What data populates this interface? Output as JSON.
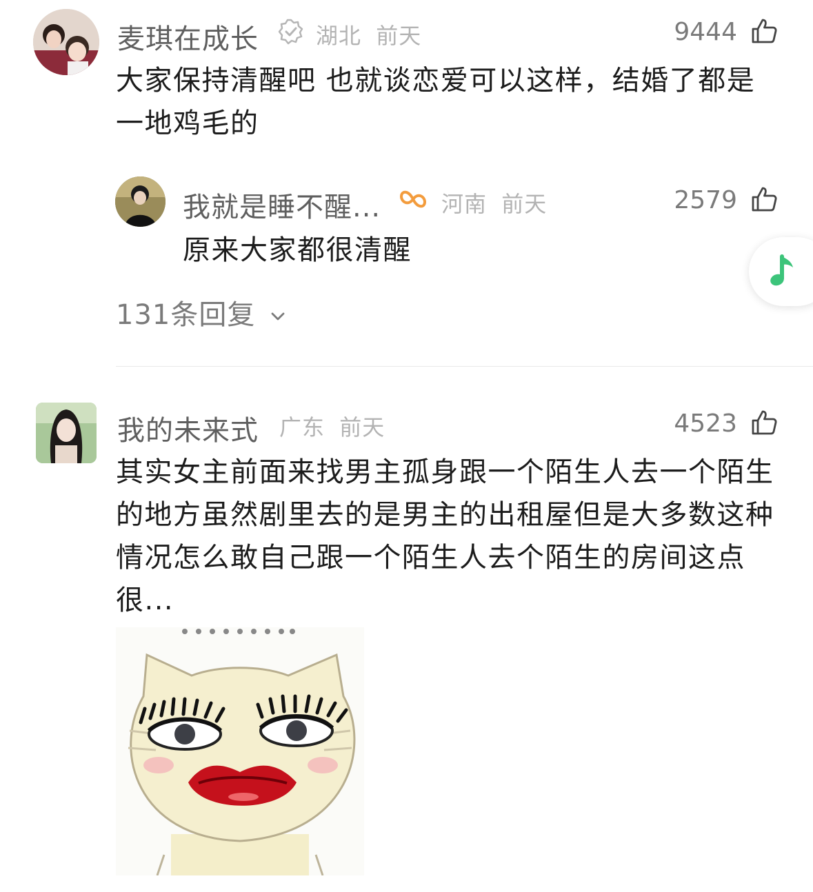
{
  "comment1": {
    "username": "麦琪在成长",
    "location": "湖北",
    "time": "前天",
    "likes": "9444",
    "text": "大家保持清醒吧 也就谈恋爱可以这样，结婚了都是一地鸡毛的",
    "verified_icon": "verified-badge-icon",
    "reply": {
      "username": "我就是睡不醒...",
      "location": "河南",
      "time": "前天",
      "likes": "2579",
      "text": "原来大家都很清醒",
      "badge_icon": "vip-ribbon-icon",
      "badge_color": "#f39c3d"
    },
    "reply_count": "131条回复"
  },
  "comment2": {
    "username": "我的未来式",
    "location": "广东",
    "time": "前天",
    "likes": "4523",
    "text": "其实女主前面来找男主孤身跟一个陌生人去一个陌生的地方虽然剧里去的是男主的出租屋但是大多数这种情况怎么敢自己跟一个陌生人去个陌生的房间这点很...",
    "sticker": "cat-face-makeup-sticker"
  },
  "music_button": {
    "icon": "music-note-icon",
    "color": "#3cc47a"
  }
}
